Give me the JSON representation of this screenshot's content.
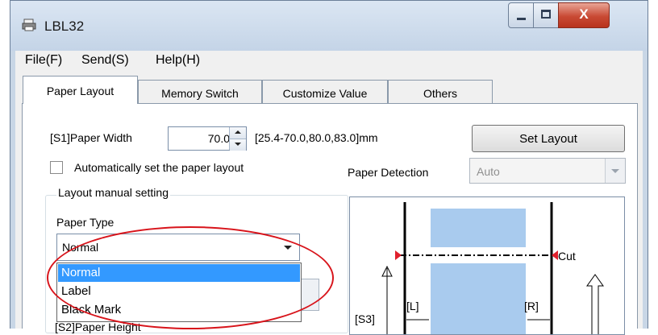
{
  "window": {
    "title": "LBL32",
    "controls": {
      "minimize": "minimize",
      "maximize": "maximize",
      "close": "X"
    }
  },
  "menubar": {
    "items": [
      "File(F)",
      "Send(S)",
      "Help(H)"
    ]
  },
  "tabs": [
    {
      "label": "Paper Layout",
      "active": true
    },
    {
      "label": "Memory Switch",
      "active": false
    },
    {
      "label": "Customize Value",
      "active": false
    },
    {
      "label": "Others",
      "active": false
    }
  ],
  "paper_layout": {
    "paper_width_label": "[S1]Paper Width",
    "paper_width_value": "70.0",
    "paper_width_range": "[25.4-70.0,80.0,83.0]mm",
    "set_layout_button": "Set Layout",
    "auto_checkbox_label": "Automatically set the paper layout",
    "auto_checkbox_checked": false,
    "paper_detection_label": "Paper Detection",
    "paper_detection_value": "Auto",
    "group_title": "Layout manual setting",
    "paper_type_label": "Paper Type",
    "paper_type_value": "Normal",
    "paper_type_options": [
      "Normal",
      "Label",
      "Black Mark"
    ],
    "paper_type_selected_option": "Normal",
    "paper_height_label_partial": "[S2]Paper Height"
  },
  "diagram": {
    "cut_label": "Cut",
    "s3_label": "[S3]",
    "l_label": "[L]",
    "r_label": "[R]"
  },
  "colors": {
    "selection": "#3399ff",
    "annotation": "#d8141b",
    "paper_block": "#a9cbee",
    "cut_marker": "#e0202c"
  },
  "icons": {
    "app": "printer-icon"
  }
}
